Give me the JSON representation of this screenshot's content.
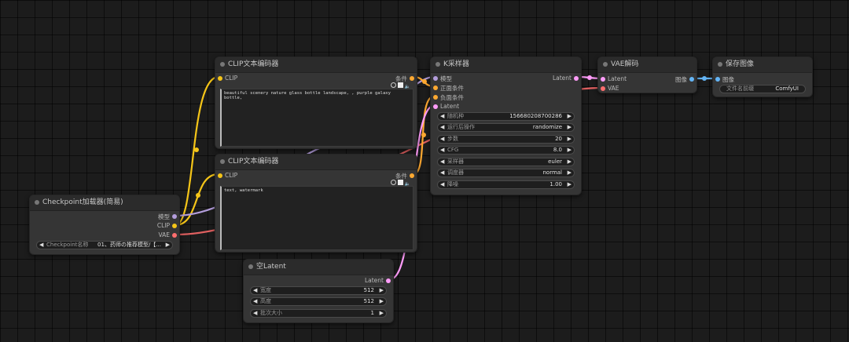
{
  "nodes": {
    "clip_pos": {
      "title": "CLIP文本编码器",
      "input_clip": "CLIP",
      "output_cond": "条件",
      "text": "beautiful scenery nature glass bottle landscape, , purple galaxy bottle,"
    },
    "clip_neg": {
      "title": "CLIP文本编码器",
      "input_clip": "CLIP",
      "output_cond": "条件",
      "text": "text, watermark"
    },
    "ksampler": {
      "title": "K采样器",
      "inputs": [
        "模型",
        "正面条件",
        "负面条件",
        "Latent"
      ],
      "output": "Latent",
      "widgets": [
        {
          "name": "随机种",
          "value": "156680208700286"
        },
        {
          "name": "运行后操作",
          "value": "randomize"
        },
        {
          "name": "步数",
          "value": "20"
        },
        {
          "name": "CFG",
          "value": "8.0"
        },
        {
          "name": "采样器",
          "value": "euler"
        },
        {
          "name": "调度器",
          "value": "normal"
        },
        {
          "name": "降噪",
          "value": "1.00"
        }
      ]
    },
    "vae_decode": {
      "title": "VAE解码",
      "inputs": [
        "Latent",
        "VAE"
      ],
      "output": "图像"
    },
    "save_image": {
      "title": "保存图像",
      "input": "图像",
      "widget_name": "文件名前缀",
      "widget_value": "ComfyUI"
    },
    "checkpoint": {
      "title": "Checkpoint加载器(简易)",
      "outputs": [
        "模型",
        "CLIP",
        "VAE"
      ],
      "widget_name": "Checkpoint名称",
      "widget_value": "01、药师の推荐模型/【..."
    },
    "empty_latent": {
      "title": "空Latent",
      "output": "Latent",
      "widgets": [
        {
          "name": "宽度",
          "value": "512"
        },
        {
          "name": "高度",
          "value": "512"
        },
        {
          "name": "批次大小",
          "value": "1"
        }
      ]
    }
  },
  "colors": {
    "clip": "#f5c518",
    "model": "#b39ddb",
    "cond": "#ffa931",
    "latent": "#ff9cf9",
    "vae": "#ff6e6e",
    "image": "#64b5f6"
  },
  "icons": {
    "node_dot": "circle-dot-icon",
    "arrow_left": "◀",
    "arrow_right": "▶",
    "speaker": "speaker-icon"
  }
}
